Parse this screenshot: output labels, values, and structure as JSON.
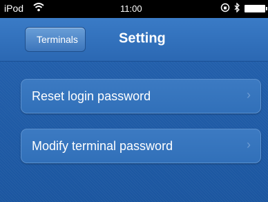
{
  "status_bar": {
    "carrier": "iPod",
    "wifi_icon": "wifi-icon",
    "time": "11:00",
    "lock_icon": "rotation-lock-icon",
    "bluetooth_icon": "bluetooth-icon",
    "battery_icon": "battery-icon"
  },
  "nav": {
    "back_label": "Terminals",
    "title": "Setting"
  },
  "rows": [
    {
      "label": "Reset login password",
      "icon": "chevron-right-icon"
    },
    {
      "label": "Modify terminal password",
      "icon": "chevron-right-icon"
    }
  ],
  "colors": {
    "nav_bar": "#3372bd",
    "background": "#1c5ca8",
    "row_background": "#3674bd",
    "text": "#ffffff"
  }
}
